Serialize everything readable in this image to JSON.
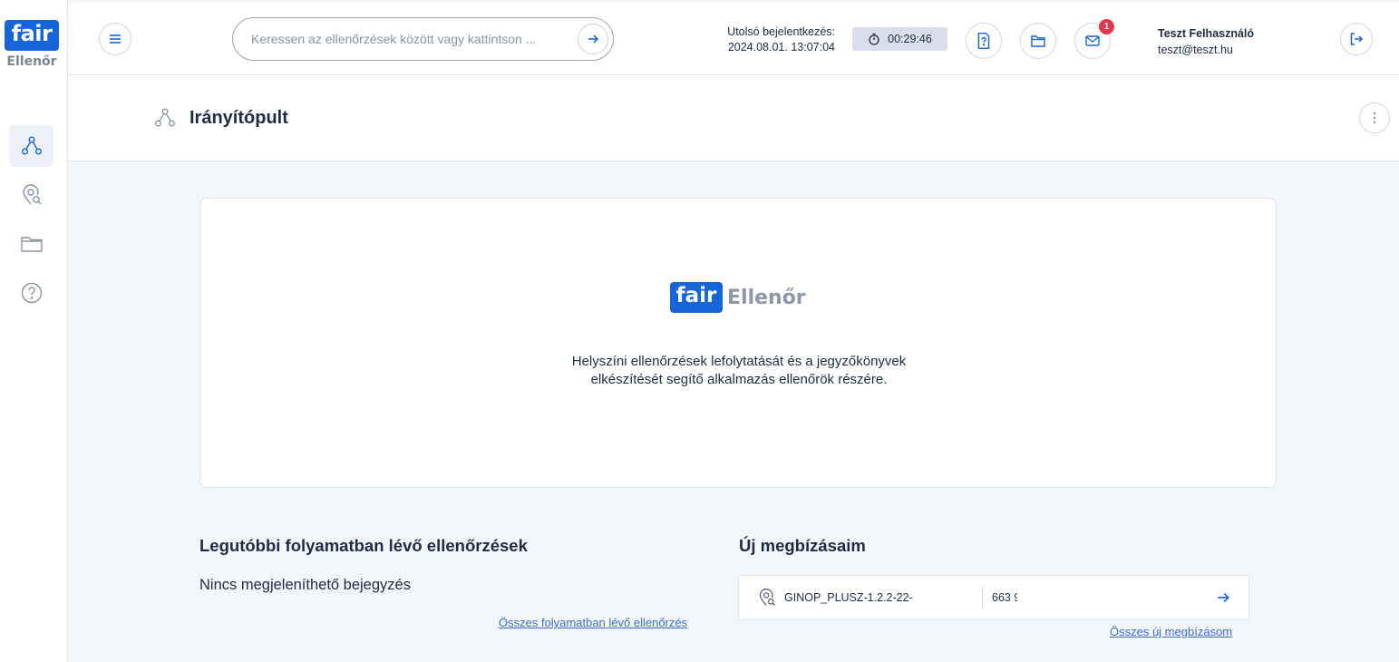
{
  "brand": {
    "logo": "fair",
    "product": "Ellenőr"
  },
  "colors": {
    "primary": "#1565d8",
    "badge": "#e5364d",
    "link": "#3a6ec8",
    "text": "#1f2a44"
  },
  "sidebar": {
    "items": [
      {
        "name": "dashboard",
        "icon": "network-icon",
        "active": true
      },
      {
        "name": "inspections",
        "icon": "location-search-icon",
        "active": false
      },
      {
        "name": "documents",
        "icon": "folder-icon",
        "active": false
      },
      {
        "name": "help",
        "icon": "help-circle-icon",
        "active": false
      }
    ]
  },
  "header": {
    "search_placeholder": "Keressen az ellenőrzések között vagy kattintson ...",
    "last_login_label": "Utolsó bejelentkezés:",
    "last_login_value": "2024.08.01. 13:07:04",
    "session_timer": "00:29:46",
    "messages_badge": "1",
    "user_name": "Teszt Felhasználó",
    "user_email": "teszt@teszt.hu"
  },
  "page": {
    "title": "Irányítópult"
  },
  "hero": {
    "logo_left": "fair",
    "logo_right": "Ellenőr",
    "description_line1": "Helyszíni ellenőrzések lefolytatását és a jegyzőkönyvek",
    "description_line2": "elkészítését segítő alkalmazás ellenőrök részére."
  },
  "recent": {
    "title": "Legutóbbi folyamatban lévő ellenőrzések",
    "empty": "Nincs megjeleníthető bejegyzés",
    "all_link": "Összes folyamatban lévő ellenőrzés"
  },
  "assignments": {
    "title": "Új megbízásaim",
    "items": [
      {
        "code": "GINOP_PLUSZ-1.2.2-22-",
        "number": "663 9"
      }
    ],
    "all_link": "Összes új megbízásom"
  }
}
